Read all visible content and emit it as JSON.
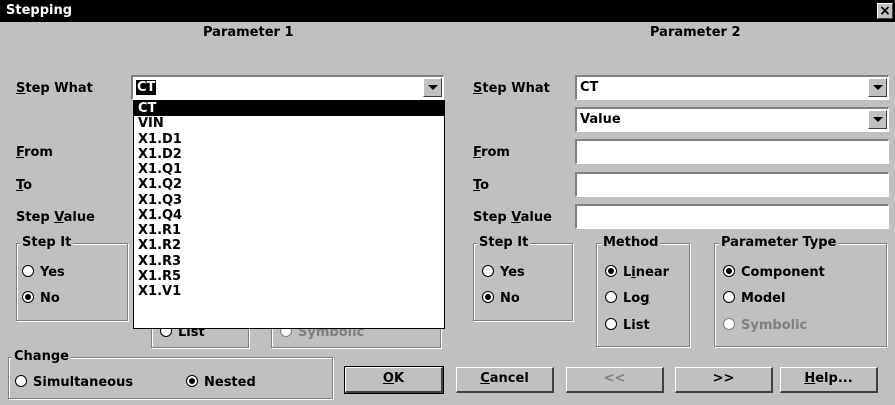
{
  "window": {
    "title": "Stepping",
    "close_label": "×"
  },
  "param1": {
    "header": "Parameter 1",
    "step_what_label_u": "S",
    "step_what_label_rest": "tep What",
    "step_what_value": "CT",
    "from_label_u": "F",
    "from_label_rest": "rom",
    "to_label_u": "T",
    "to_label_rest": "o",
    "step_value_label_a": "Step ",
    "step_value_label_u": "V",
    "step_value_label_b": "alue",
    "step_it": {
      "title": "Step It",
      "yes": "Yes",
      "no": "No",
      "selected": "No"
    },
    "hidden_partial": {
      "list": "List",
      "symbolic": "Symbolic"
    },
    "dropdown_items": [
      "CT",
      "VIN",
      "X1.D1",
      "X1.D2",
      "X1.Q1",
      "X1.Q2",
      "X1.Q3",
      "X1.Q4",
      "X1.R1",
      "X1.R2",
      "X1.R3",
      "X1.R5",
      "X1.V1"
    ]
  },
  "param2": {
    "header": "Parameter 2",
    "step_what_label_u": "S",
    "step_what_label_rest": "tep What",
    "step_what_value": "CT",
    "value_type": "Value",
    "from_label_u": "F",
    "from_label_rest": "rom",
    "to_label_u": "T",
    "to_label_rest": "o",
    "step_value_label_a": "Step ",
    "step_value_label_u": "V",
    "step_value_label_b": "alue",
    "step_it": {
      "title": "Step It",
      "yes": "Yes",
      "no": "No",
      "selected": "No"
    },
    "method": {
      "title": "Method",
      "linear_a": "L",
      "linear_u": "i",
      "linear_b": "near",
      "log_a": "Lo",
      "log_u": "g",
      "list": "List",
      "selected": "Linear"
    },
    "parameter_type": {
      "title": "Parameter Type",
      "component": "Component",
      "model": "Model",
      "symbolic": "Symbolic",
      "selected": "Component"
    }
  },
  "change": {
    "title": "Change",
    "simultaneous": "Simultaneous",
    "nested": "Nested",
    "selected": "Nested"
  },
  "buttons": {
    "ok_u": "O",
    "ok_rest": "K",
    "cancel_u": "C",
    "cancel_rest": "ancel",
    "prev": "<<",
    "next": ">>",
    "help_u": "H",
    "help_rest": "elp..."
  }
}
